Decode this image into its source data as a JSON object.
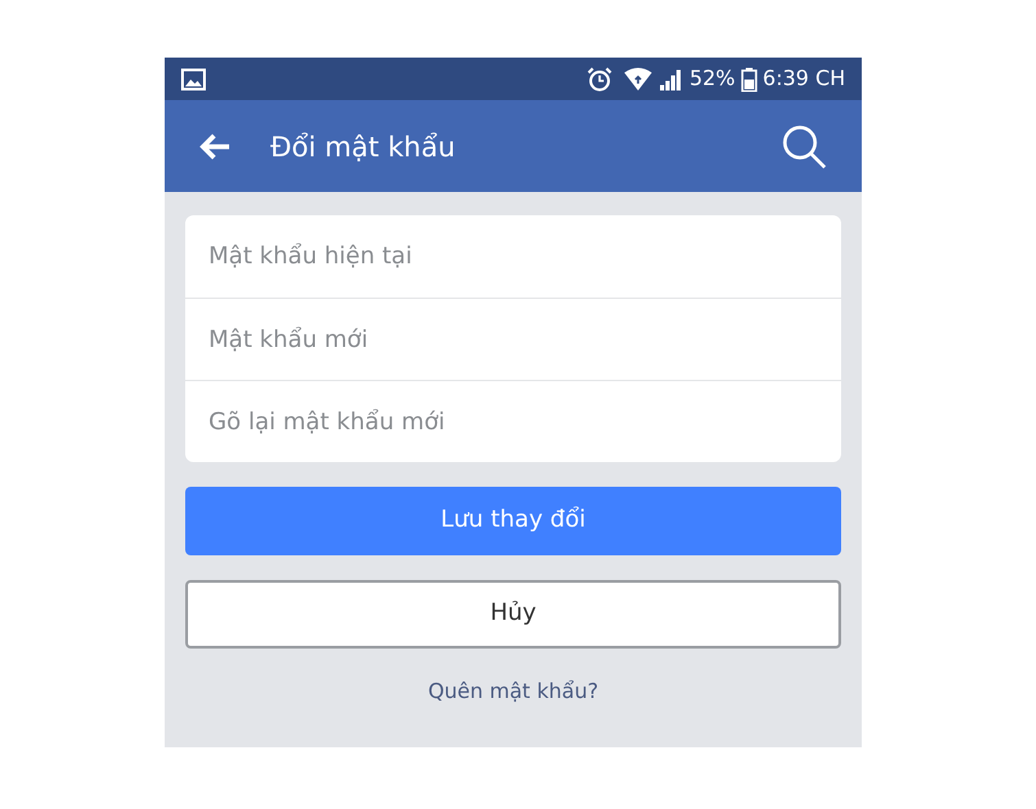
{
  "status_bar": {
    "battery": "52%",
    "time": "6:39 CH"
  },
  "header": {
    "title": "Đổi mật khẩu"
  },
  "fields": [
    {
      "placeholder": "Mật khẩu hiện tại"
    },
    {
      "placeholder": "Mật khẩu mới"
    },
    {
      "placeholder": "Gõ lại mật khẩu mới"
    }
  ],
  "buttons": [
    {
      "label": "Lưu thay đổi",
      "kind": "primary"
    },
    {
      "label": "Hủy",
      "kind": "secondary"
    }
  ],
  "link": "Quên mật khẩu?"
}
